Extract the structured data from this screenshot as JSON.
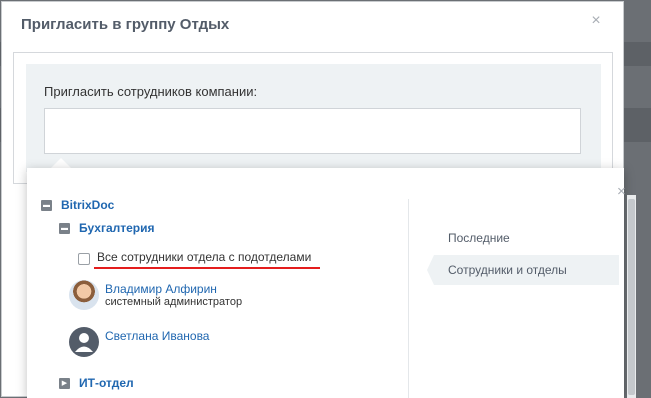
{
  "dialog": {
    "title": "Пригласить в группу Отдых",
    "close_glyph": "×",
    "invite_label": "Пригласить сотрудников компании:",
    "invite_value": ""
  },
  "popup": {
    "close_glyph": "×",
    "tree": {
      "root": {
        "label": "BitrixDoc",
        "toggle_glyph": "■"
      },
      "dept": {
        "label": "Бухгалтерия",
        "toggle_glyph": "■"
      },
      "select_all_label": "Все сотрудники отдела с подотделами",
      "people": [
        {
          "name": "Владимир Алфирин",
          "position": "системный администратор",
          "avatar": "user-photo"
        },
        {
          "name": "Светлана Иванова",
          "position": "",
          "avatar": "default-user-icon"
        }
      ],
      "next_dept": {
        "label": "ИТ-отдел",
        "toggle_glyph": "▶"
      }
    },
    "tabs": [
      {
        "label": "Последние",
        "active": false
      },
      {
        "label": "Сотрудники и отделы",
        "active": true
      }
    ]
  },
  "colors": {
    "accent_link": "#2067b0",
    "highlight_underline": "#e41d1d",
    "tab_active_bg": "#eef2f4"
  }
}
